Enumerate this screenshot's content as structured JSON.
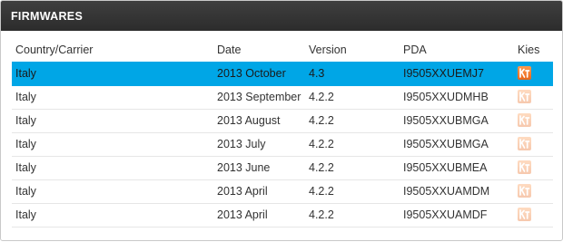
{
  "header": {
    "title": "FIRMWARES"
  },
  "columns": [
    "Country/Carrier",
    "Date",
    "Version",
    "PDA",
    "Kies"
  ],
  "rows": [
    {
      "country": "Italy",
      "date": "2013 October",
      "version": "4.3",
      "pda": "I9505XXUEMJ7",
      "kies_icon": "kies-icon",
      "selected": true
    },
    {
      "country": "Italy",
      "date": "2013 September",
      "version": "4.2.2",
      "pda": "I9505XXUDMHB",
      "kies_icon": "kies-icon",
      "selected": false
    },
    {
      "country": "Italy",
      "date": "2013 August",
      "version": "4.2.2",
      "pda": "I9505XXUBMGA",
      "kies_icon": "kies-icon",
      "selected": false
    },
    {
      "country": "Italy",
      "date": "2013 July",
      "version": "4.2.2",
      "pda": "I9505XXUBMGA",
      "kies_icon": "kies-icon",
      "selected": false
    },
    {
      "country": "Italy",
      "date": "2013 June",
      "version": "4.2.2",
      "pda": "I9505XXUBMEA",
      "kies_icon": "kies-icon",
      "selected": false
    },
    {
      "country": "Italy",
      "date": "2013 April",
      "version": "4.2.2",
      "pda": "I9505XXUAMDM",
      "kies_icon": "kies-icon",
      "selected": false
    },
    {
      "country": "Italy",
      "date": "2013 April",
      "version": "4.2.2",
      "pda": "I9505XXUAMDF",
      "kies_icon": "kies-icon",
      "selected": false
    }
  ],
  "colors": {
    "header_bg": "#333333",
    "selected_row": "#00a6e6",
    "kies_orange": "#f07a2a"
  }
}
